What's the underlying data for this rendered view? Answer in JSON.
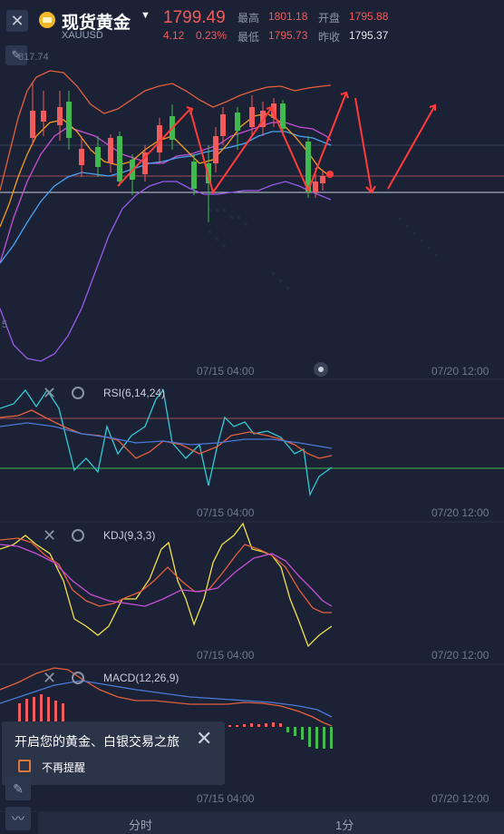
{
  "header": {
    "title": "现货黄金",
    "symbol": "XAUUSD",
    "price": "1799.49",
    "change": "4.12",
    "change_pct": "0.23%",
    "high_label": "最高",
    "high_value": "1801.18",
    "open_label": "开盘",
    "open_value": "1795.88",
    "low_label": "最低",
    "low_value": "1795.73",
    "prev_close_label": "昨收",
    "prev_close_value": "1795.37"
  },
  "main_chart": {
    "y_labels": [
      "817.74",
      "5"
    ],
    "time_labels": [
      "07/15 04:00",
      "07/20 12:00"
    ]
  },
  "rsi": {
    "label": "RSI(6,14,24)",
    "time_labels": [
      "07/15 04:00",
      "07/20 12:00"
    ]
  },
  "kdj": {
    "label": "KDJ(9,3,3)",
    "time_labels": [
      "07/15 04:00",
      "07/20 12:00"
    ]
  },
  "macd": {
    "label": "MACD(12,26,9)",
    "time_labels": [
      "07/15 04:00",
      "07/20 12:00"
    ]
  },
  "popup": {
    "title": "开启您的黄金、白银交易之旅",
    "checkbox_label": "不再提醒"
  },
  "bottom_tabs": [
    "分时",
    "1分"
  ],
  "colors": {
    "background": "#1b2236",
    "up": "#f15b5b",
    "down": "#3fb950",
    "arrow": "#ff3b3b"
  }
}
